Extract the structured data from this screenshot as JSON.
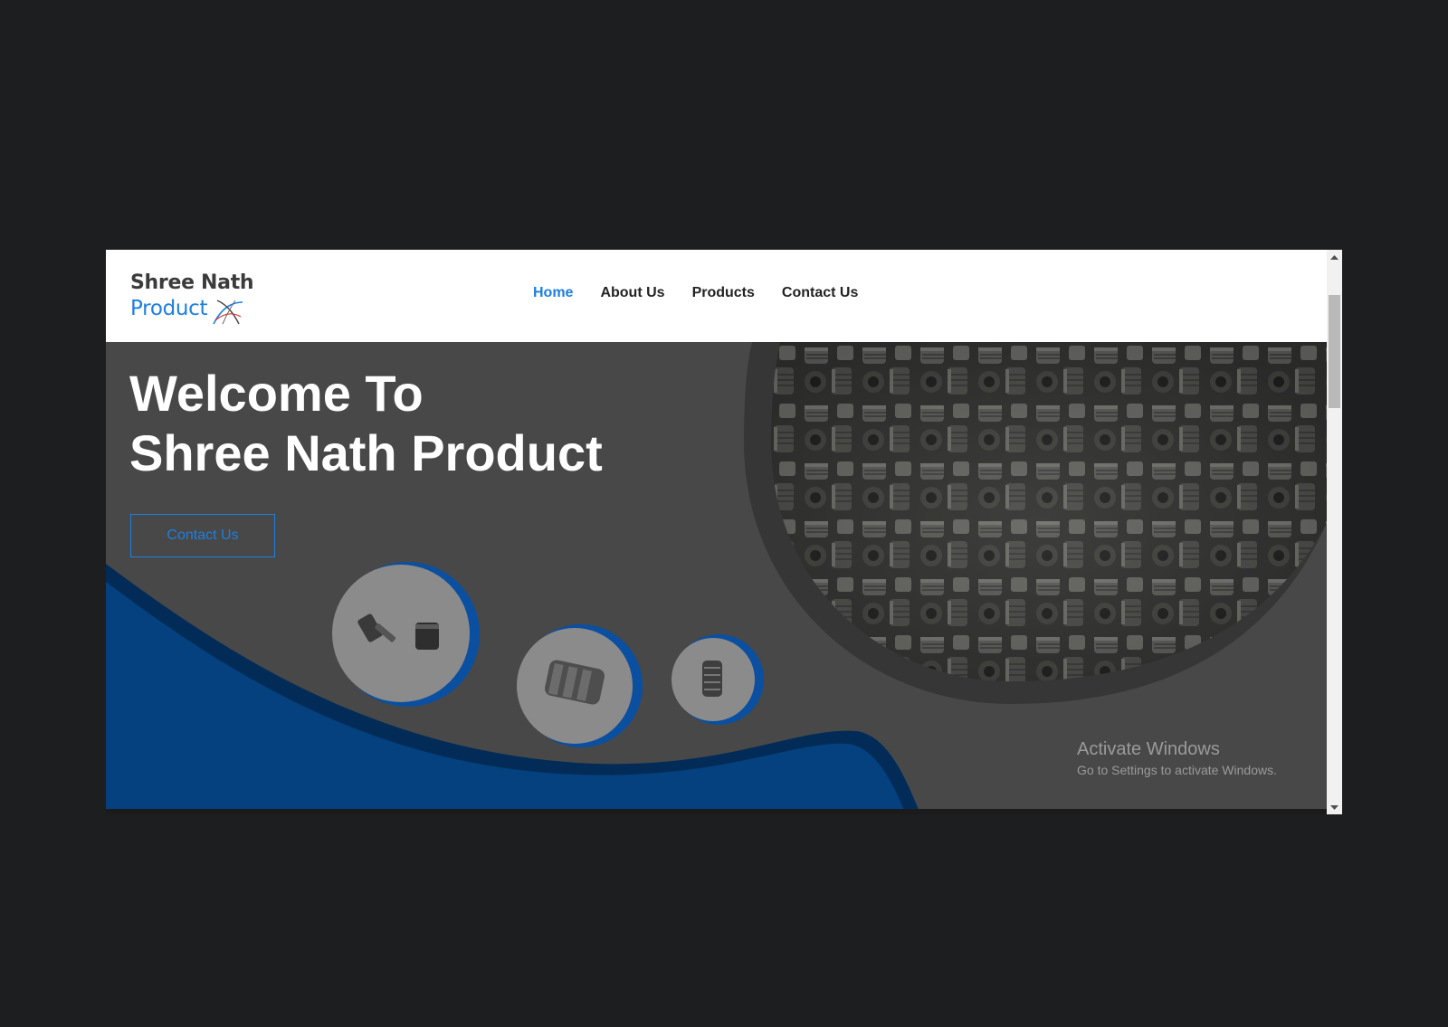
{
  "logo": {
    "line1": "Shree Nath",
    "line2": "Product"
  },
  "nav": {
    "items": [
      {
        "label": "Home",
        "active": true
      },
      {
        "label": "About Us"
      },
      {
        "label": "Products"
      },
      {
        "label": "Contact Us"
      }
    ]
  },
  "hero": {
    "title_line1": "Welcome To",
    "title_line2": "Shree Nath Product",
    "cta_label": "Contact Us"
  },
  "watermark": {
    "title": "Activate Windows",
    "subtitle": "Go to Settings to activate Windows."
  },
  "colors": {
    "page_background": "#1d1e20",
    "accent": "#1e7fe0",
    "hero_background": "#484848",
    "wave_blue": "#04417e"
  },
  "icons": [
    "logo-swoosh-icon",
    "scroll-up-arrow-icon",
    "scroll-down-arrow-icon"
  ]
}
